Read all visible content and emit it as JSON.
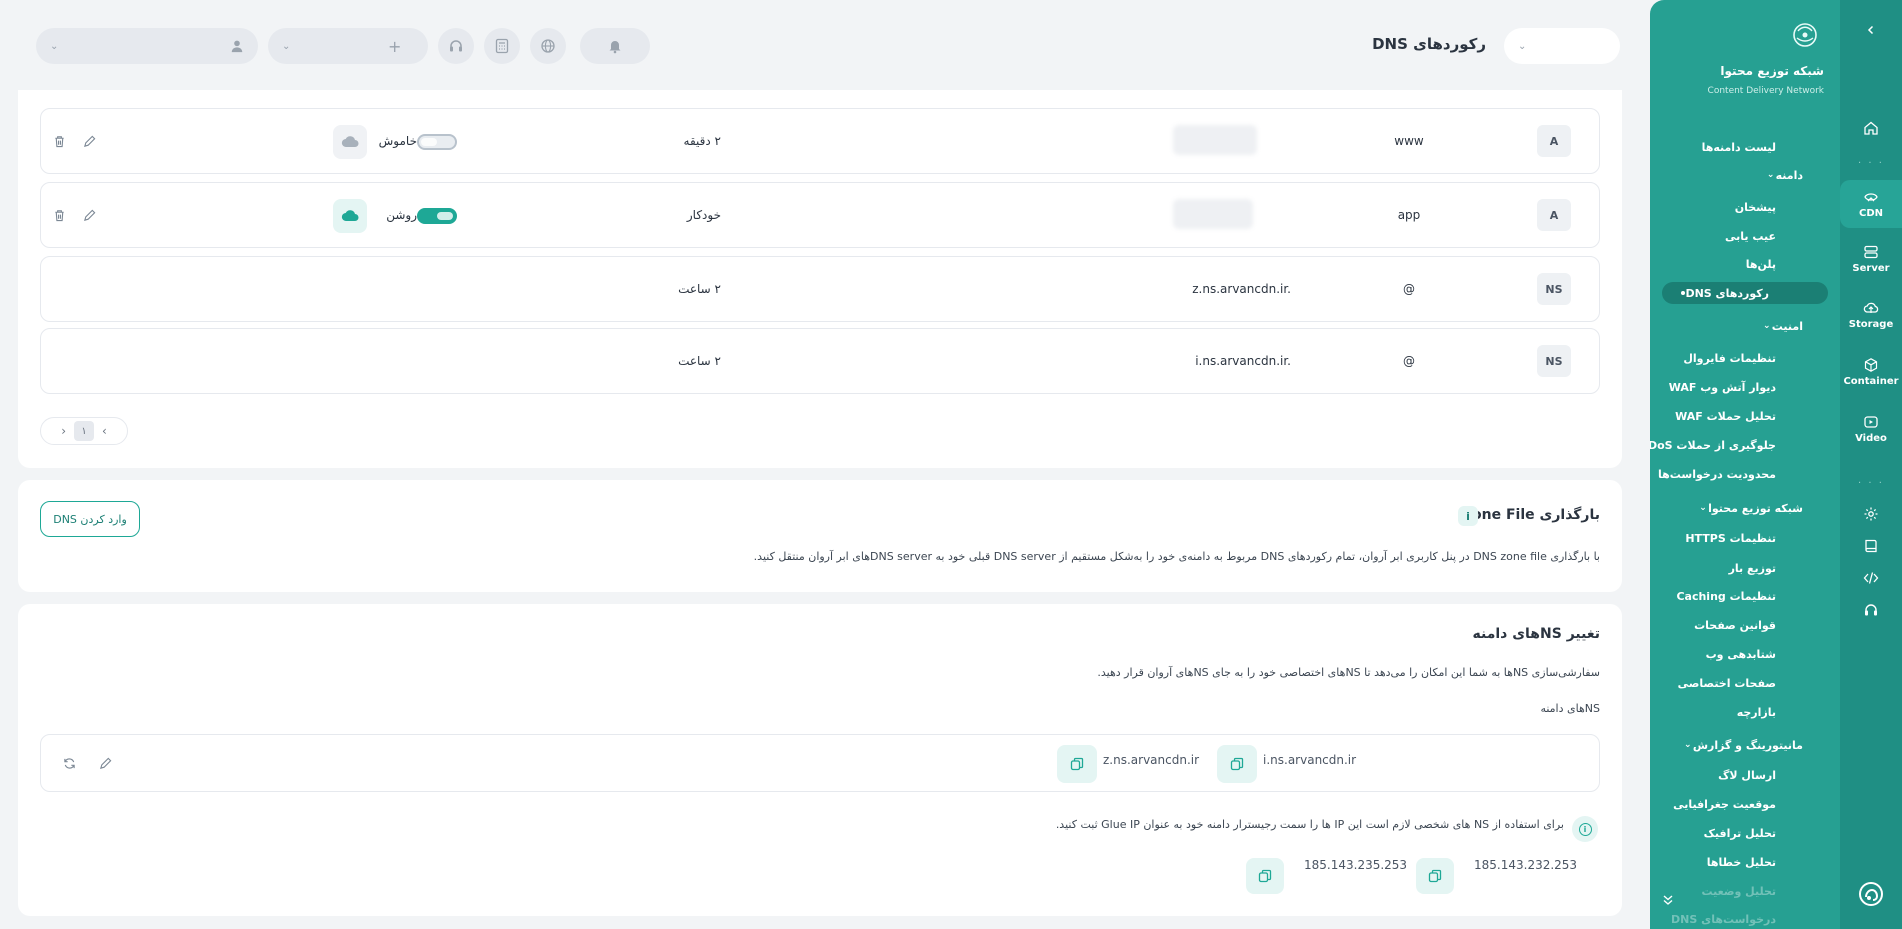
{
  "topbar": {
    "page_title": "رکوردهای DNS",
    "add_label": "+"
  },
  "sidebar": {
    "brand_title": "شبکه توزیع محتوا",
    "brand_subtitle": "Content Delivery Network",
    "items": [
      {
        "label": "لیست دامنه‌ها"
      },
      {
        "label": "دامنه",
        "group": true
      },
      {
        "label": "پیشخان"
      },
      {
        "label": "عیب یابی"
      },
      {
        "label": "پلن‌ها"
      },
      {
        "label": "رکوردهای DNS",
        "active": true
      },
      {
        "label": "امنیت",
        "group": true
      },
      {
        "label": "تنظیمات فایروال"
      },
      {
        "label": "دیوار آتش وب WAF"
      },
      {
        "label": "تحلیل حملات WAF"
      },
      {
        "label": "جلوگیری از حملات DDoS"
      },
      {
        "label": "محدودیت درخواست‌ها"
      },
      {
        "label": "شبکه توزیع محتوا",
        "group": true
      },
      {
        "label": "تنظیمات HTTPS"
      },
      {
        "label": "توزیع بار"
      },
      {
        "label": "تنظیمات Caching"
      },
      {
        "label": "قوانین صفحات"
      },
      {
        "label": "شتابدهی وب"
      },
      {
        "label": "صفحات اختصاصی"
      },
      {
        "label": "بازارچه"
      },
      {
        "label": "مانیتورینگ و گزارش",
        "group": true
      },
      {
        "label": "ارسال لاگ"
      },
      {
        "label": "موقعیت جغرافیایی"
      },
      {
        "label": "تحلیل ترافیک"
      },
      {
        "label": "تحلیل خطاها"
      },
      {
        "label": "تحلیل وضعیت"
      },
      {
        "label": "درخواست‌های DNS"
      }
    ]
  },
  "rail": {
    "items": [
      {
        "label": "CDN",
        "icon": "cdn-icon"
      },
      {
        "label": "Server",
        "icon": "server-icon"
      },
      {
        "label": "Storage",
        "icon": "storage-icon"
      },
      {
        "label": "Container",
        "icon": "container-icon"
      },
      {
        "label": "Video",
        "icon": "video-icon"
      }
    ]
  },
  "records": [
    {
      "type": "A",
      "name": "www",
      "value": "",
      "ttl": "۲ دقیقه",
      "cloud_label": "خاموش",
      "cloud_on": false,
      "toggle_text": "OFF"
    },
    {
      "type": "A",
      "name": "app",
      "value": "",
      "ttl": "خودکار",
      "cloud_label": "روشن",
      "cloud_on": true,
      "toggle_text": "ON"
    },
    {
      "type": "NS",
      "name": "@",
      "value": "z.ns.arvancdn.ir.",
      "ttl": "۲ ساعت"
    },
    {
      "type": "NS",
      "name": "@",
      "value": "i.ns.arvancdn.ir.",
      "ttl": "۲ ساعت"
    }
  ],
  "pagination": {
    "current": "۱",
    "prev": "‹",
    "next": "›"
  },
  "zone": {
    "title": "بارگذاری Zone File",
    "info": "i",
    "button": "وارد کردن DNS",
    "description": "با بارگذاری DNS zone file در پنل کاربری ابر آروان، تمام رکوردهای DNS مربوط به دامنه‌ی خود را به‌شکل مستقیم از DNS server قبلی خود به DNS serverهای ابر آروان منتقل کنید."
  },
  "ns": {
    "title": "تغییر NSهای دامنه",
    "description": "سفارشی‌سازی NSها به شما این امکان را می‌دهد تا NSهای اختصاصی خود را به جای NSهای آروان قرار دهید.",
    "label": "NSهای دامنه",
    "servers": [
      "i.ns.arvancdn.ir",
      "z.ns.arvancdn.ir"
    ],
    "glue_note": "برای استفاده از NS های شخصی لازم است این IP ها را سمت رجیسترار دامنه خود به عنوان Glue IP ثبت کنید.",
    "info": "i",
    "ips": [
      "185.143.232.253",
      "185.143.235.253"
    ]
  },
  "colors": {
    "accent": "#1ea896",
    "sidebar": "#26a092",
    "rail": "#1f8f84"
  }
}
